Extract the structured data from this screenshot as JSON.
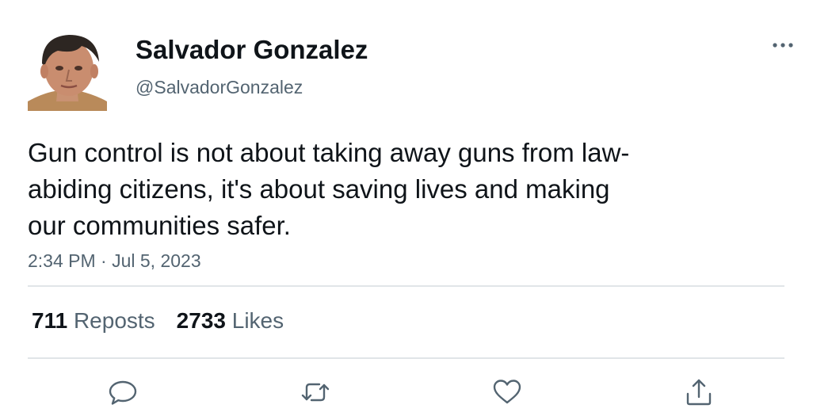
{
  "author": {
    "display_name": "Salvador Gonzalez",
    "handle": "@SalvadorGonzalez",
    "avatar_icon": "avatar-photo"
  },
  "tweet": {
    "text": "Gun control is not about taking away guns from law-\nabiding citizens, it's about saving lives and making\nour communities safer.",
    "timestamp": "2:34 PM · Jul 5, 2023"
  },
  "stats": {
    "reposts_count": "711",
    "reposts_label": "Reposts",
    "likes_count": "2733",
    "likes_label": "Likes"
  },
  "actions": {
    "reply_icon": "reply-icon",
    "repost_icon": "repost-icon",
    "like_icon": "heart-icon",
    "share_icon": "share-icon",
    "more_icon": "more-icon"
  },
  "colors": {
    "text": "#0f1419",
    "secondary_text": "#536471",
    "divider": "#e1e5e8",
    "icon": "#536471"
  }
}
